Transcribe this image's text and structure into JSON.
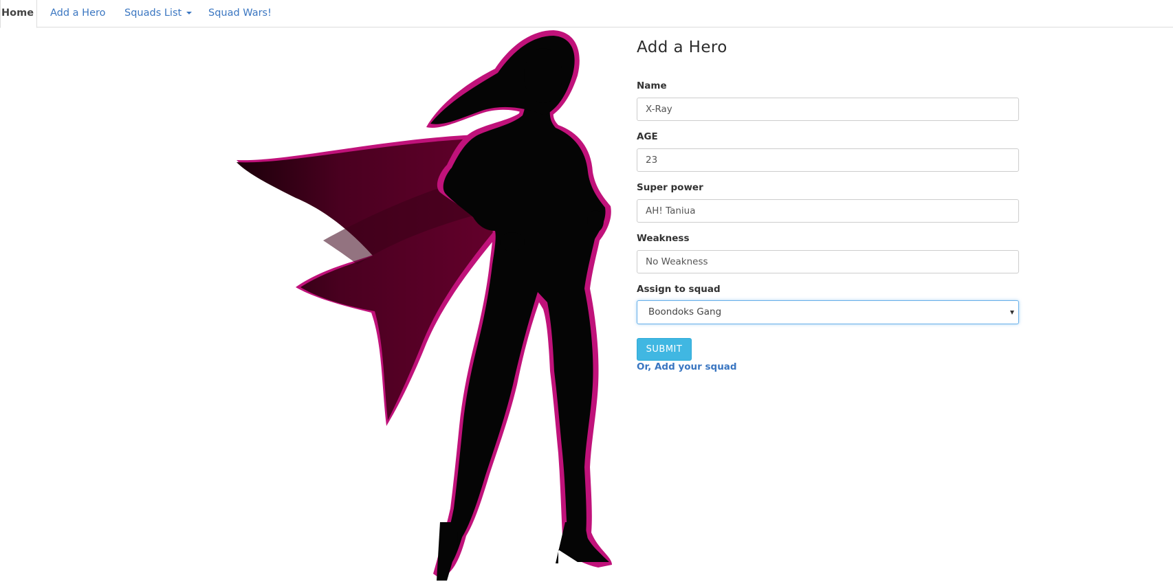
{
  "nav": {
    "items": [
      {
        "label": "Home",
        "active": true
      },
      {
        "label": "Add a Hero",
        "active": false
      },
      {
        "label": "Squads List",
        "active": false,
        "dropdown": true
      },
      {
        "label": "Squad Wars!",
        "active": false
      }
    ]
  },
  "hero_image": {
    "icon": "superheroine-silhouette-icon",
    "colors": {
      "body": "#050505",
      "outline": "#c0127a",
      "cape_dark": "#2a0010",
      "cape_mid": "#5c0027"
    }
  },
  "form": {
    "title": "Add a Hero",
    "fields": {
      "name": {
        "label": "Name",
        "value": "X-Ray"
      },
      "age": {
        "label": "AGE",
        "value": "23"
      },
      "super_power": {
        "label": "Super power",
        "value": "AH! Taniua"
      },
      "weakness": {
        "label": "Weakness",
        "value": "No Weakness"
      }
    },
    "squad": {
      "label": "Assign to squad",
      "selected": "Boondoks Gang"
    },
    "submit_label": "SUBMIT",
    "add_squad_link": "Or, Add your squad"
  },
  "colors": {
    "link": "#3a76c1",
    "submit": "#40b7e2",
    "focus": "#66afe9"
  }
}
